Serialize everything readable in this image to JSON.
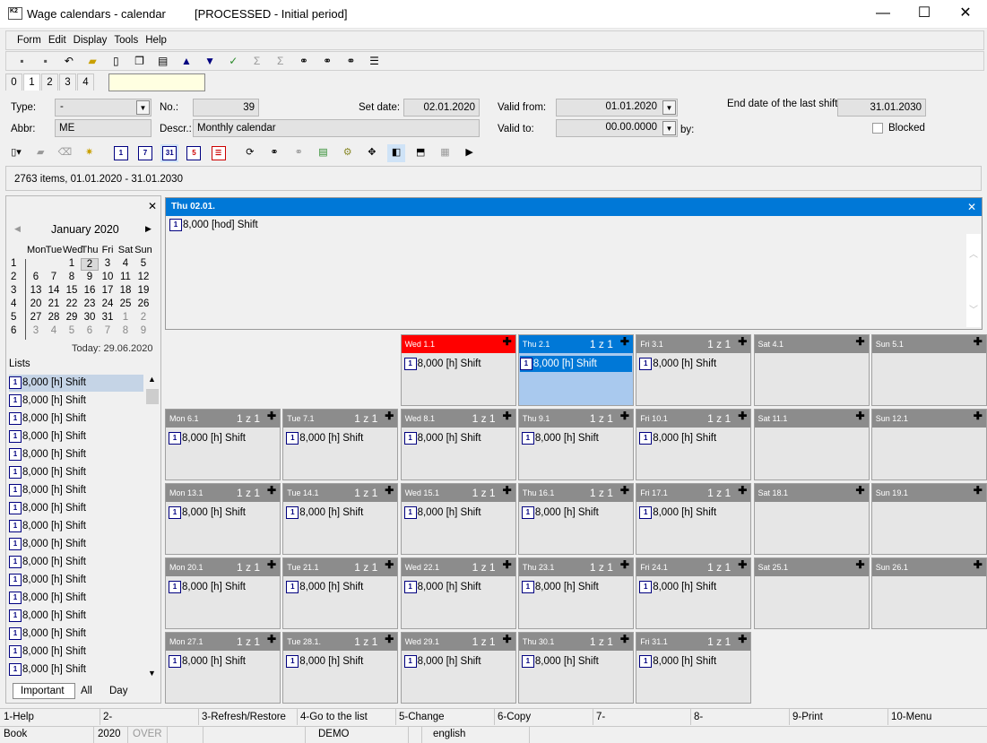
{
  "window": {
    "app_title": "Wage calendars - calendar",
    "status_title": "[PROCESSED - Initial period]",
    "minimize": "—",
    "maximize": "☐",
    "close": "✕"
  },
  "menu": [
    "Form",
    "Edit",
    "Display",
    "Tools",
    "Help"
  ],
  "tabs": [
    "0",
    "1",
    "2",
    "3",
    "4"
  ],
  "form": {
    "type_label": "Type:",
    "type_value": "-",
    "abbr_label": "Abbr:",
    "abbr_value": "ME",
    "no_label": "No.:",
    "no_value": "39",
    "descr_label": "Descr.:",
    "descr_value": "Monthly calendar",
    "set_date_label": "Set date:",
    "set_date_value": "02.01.2020",
    "valid_from_label": "Valid from:",
    "valid_from_value": "01.01.2020",
    "valid_to_label": "Valid to:",
    "valid_to_value": "00.00.0000",
    "by_label": "by:",
    "end_date_label": "End date of the last shift:",
    "end_date_value": "31.01.2030",
    "blocked_label": "Blocked"
  },
  "info_line": "2763 items, 01.01.2020 - 31.01.2030",
  "mini_calendar": {
    "month": "January 2020",
    "weekdays": [
      "Mon",
      "Tue",
      "Wed",
      "Thu",
      "Fri",
      "Sat",
      "Sun"
    ],
    "weeks": [
      {
        "no": "1",
        "days": [
          "",
          "",
          "1",
          "2",
          "3",
          "4",
          "5"
        ]
      },
      {
        "no": "2",
        "days": [
          "6",
          "7",
          "8",
          "9",
          "10",
          "11",
          "12"
        ]
      },
      {
        "no": "3",
        "days": [
          "13",
          "14",
          "15",
          "16",
          "17",
          "18",
          "19"
        ]
      },
      {
        "no": "4",
        "days": [
          "20",
          "21",
          "22",
          "23",
          "24",
          "25",
          "26"
        ]
      },
      {
        "no": "5",
        "days": [
          "27",
          "28",
          "29",
          "30",
          "31",
          "1",
          "2"
        ]
      },
      {
        "no": "6",
        "days": [
          "3",
          "4",
          "5",
          "6",
          "7",
          "8",
          "9"
        ]
      }
    ],
    "today": "Today: 29.06.2020"
  },
  "lists_label": "Lists",
  "list_items": [
    "8,000 [h] Shift",
    "8,000 [h] Shift",
    "8,000 [h] Shift",
    "8,000 [h] Shift",
    "8,000 [h] Shift",
    "8,000 [h] Shift",
    "8,000 [h] Shift",
    "8,000 [h] Shift",
    "8,000 [h] Shift",
    "8,000 [h] Shift",
    "8,000 [h] Shift",
    "8,000 [h] Shift",
    "8,000 [h] Shift",
    "8,000 [h] Shift",
    "8,000 [h] Shift",
    "8,000 [h] Shift",
    "8,000 [h] Shift"
  ],
  "bottom_tabs": [
    "Important",
    "All",
    "Day"
  ],
  "day_detail": {
    "header": "Thu 02.01.",
    "entry": "8,000 [hod] Shift"
  },
  "calendar_cells": [
    {
      "label": "Wed 1.1",
      "count": "",
      "shift": "8,000 [h] Shift",
      "state": "holiday"
    },
    {
      "label": "Thu 2.1",
      "count": "1 z 1",
      "shift": "8,000 [h] Shift",
      "state": "selected"
    },
    {
      "label": "Fri 3.1",
      "count": "1 z 1",
      "shift": "8,000 [h] Shift",
      "state": "normal"
    },
    {
      "label": "Sat 4.1",
      "count": "",
      "shift": "",
      "state": "normal"
    },
    {
      "label": "Sun 5.1",
      "count": "",
      "shift": "",
      "state": "normal"
    },
    {
      "label": "Mon 6.1",
      "count": "1 z 1",
      "shift": "8,000 [h] Shift",
      "state": "normal"
    },
    {
      "label": "Tue 7.1",
      "count": "1 z 1",
      "shift": "8,000 [h] Shift",
      "state": "normal"
    },
    {
      "label": "Wed 8.1",
      "count": "1 z 1",
      "shift": "8,000 [h] Shift",
      "state": "normal"
    },
    {
      "label": "Thu 9.1",
      "count": "1 z 1",
      "shift": "8,000 [h] Shift",
      "state": "normal"
    },
    {
      "label": "Fri 10.1",
      "count": "1 z 1",
      "shift": "8,000 [h] Shift",
      "state": "normal"
    },
    {
      "label": "Sat 11.1",
      "count": "",
      "shift": "",
      "state": "normal"
    },
    {
      "label": "Sun 12.1",
      "count": "",
      "shift": "",
      "state": "normal"
    },
    {
      "label": "Mon 13.1",
      "count": "1 z 1",
      "shift": "8,000 [h] Shift",
      "state": "normal"
    },
    {
      "label": "Tue 14.1",
      "count": "1 z 1",
      "shift": "8,000 [h] Shift",
      "state": "normal"
    },
    {
      "label": "Wed 15.1",
      "count": "1 z 1",
      "shift": "8,000 [h] Shift",
      "state": "normal"
    },
    {
      "label": "Thu 16.1",
      "count": "1 z 1",
      "shift": "8,000 [h] Shift",
      "state": "normal"
    },
    {
      "label": "Fri 17.1",
      "count": "1 z 1",
      "shift": "8,000 [h] Shift",
      "state": "normal"
    },
    {
      "label": "Sat 18.1",
      "count": "",
      "shift": "",
      "state": "normal"
    },
    {
      "label": "Sun 19.1",
      "count": "",
      "shift": "",
      "state": "normal"
    },
    {
      "label": "Mon 20.1",
      "count": "1 z 1",
      "shift": "8,000 [h] Shift",
      "state": "normal"
    },
    {
      "label": "Tue 21.1",
      "count": "1 z 1",
      "shift": "8,000 [h] Shift",
      "state": "normal"
    },
    {
      "label": "Wed 22.1",
      "count": "1 z 1",
      "shift": "8,000 [h] Shift",
      "state": "normal"
    },
    {
      "label": "Thu 23.1",
      "count": "1 z 1",
      "shift": "8,000 [h] Shift",
      "state": "normal"
    },
    {
      "label": "Fri 24.1",
      "count": "1 z 1",
      "shift": "8,000 [h] Shift",
      "state": "normal"
    },
    {
      "label": "Sat 25.1",
      "count": "",
      "shift": "",
      "state": "normal"
    },
    {
      "label": "Sun 26.1",
      "count": "",
      "shift": "",
      "state": "normal"
    },
    {
      "label": "Mon 27.1",
      "count": "1 z 1",
      "shift": "8,000 [h] Shift",
      "state": "normal"
    },
    {
      "label": "Tue 28.1.",
      "count": "1 z 1",
      "shift": "8,000 [h] Shift",
      "state": "normal"
    },
    {
      "label": "Wed 29.1",
      "count": "1 z 1",
      "shift": "8,000 [h] Shift",
      "state": "normal"
    },
    {
      "label": "Thu 30.1",
      "count": "1 z 1",
      "shift": "8,000 [h] Shift",
      "state": "normal"
    },
    {
      "label": "Fri 31.1",
      "count": "1 z 1",
      "shift": "8,000 [h] Shift",
      "state": "normal"
    }
  ],
  "fkeys": [
    "1-Help",
    "2-",
    "3-Refresh/Restore",
    "4-Go to the list",
    "5-Change",
    "6-Copy",
    "7-",
    "8-",
    "9-Print",
    "10-Menu"
  ],
  "statusbar": {
    "module": "Book",
    "year": "2020",
    "mode": "OVER",
    "db": "DEMO",
    "lang": "english"
  },
  "colors": {
    "selected_header": "#0078d7",
    "selected_body": "#a9c9ee",
    "holiday_header": "#ff0000",
    "cell_header": "#8c8c8c"
  }
}
